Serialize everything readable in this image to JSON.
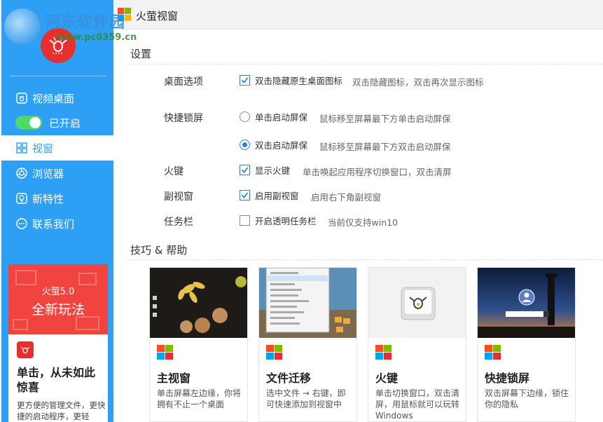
{
  "watermark": {
    "text": "河东软件园",
    "url": "www.pc0359.cn"
  },
  "window": {
    "title": "火萤视窗"
  },
  "sidebar": {
    "items": [
      {
        "label": "视频桌面"
      },
      {
        "label": "已开启"
      },
      {
        "label": "视窗"
      },
      {
        "label": "浏览器"
      },
      {
        "label": "新特性"
      },
      {
        "label": "联系我们"
      }
    ],
    "promo": {
      "banner_line1": "火萤5.0",
      "banner_line2": "全新玩法",
      "title": "单击，从未如此惊喜",
      "desc": "更方便的管理文件，更快捷的启动程序，更轻"
    }
  },
  "settings": {
    "title": "设置",
    "rows": {
      "desktop_options": {
        "label": "桌面选项",
        "option": "双击隐藏原生桌面图标",
        "checked": true,
        "hint": "双击隐藏图标，双击再次显示图标"
      },
      "quick_lock": {
        "label": "快捷锁屏",
        "option1": "单击启动屏保",
        "hint1": "鼠标移至屏幕最下方单击启动屏保",
        "option1_selected": false,
        "option2": "双击启动屏保",
        "hint2": "鼠标移至屏幕最下方双击启动屏保",
        "option2_selected": true
      },
      "hotkey": {
        "label": "火键",
        "option": "显示火键",
        "checked": true,
        "hint": "单击唤起应用程序切换窗口，双击清屏"
      },
      "sub_window": {
        "label": "副视窗",
        "option": "启用副视窗",
        "checked": true,
        "hint": "启用右下角副视窗"
      },
      "taskbar": {
        "label": "任务栏",
        "option": "开启透明任务栏",
        "checked": false,
        "hint": "当前仅支持win10"
      }
    }
  },
  "help": {
    "title": "技巧 & 帮助",
    "cards": [
      {
        "title": "主视窗",
        "desc": "单击屏幕左边缘，你将拥有不止一个桌面"
      },
      {
        "title": "文件迁移",
        "desc": "选中文件 → 右键，即可快速添加到视窗中"
      },
      {
        "title": "火键",
        "desc": "单击切换窗口，双击清屏，用鼠标就可以玩转Windows"
      },
      {
        "title": "快捷锁屏",
        "desc": "双击屏幕下边缘，锁住你的隐私"
      }
    ]
  },
  "colors": {
    "sidebar": "#2d9ff5",
    "brand_red": "#e63030",
    "toggle_on": "#4cd964",
    "check": "#2d7fd8"
  }
}
